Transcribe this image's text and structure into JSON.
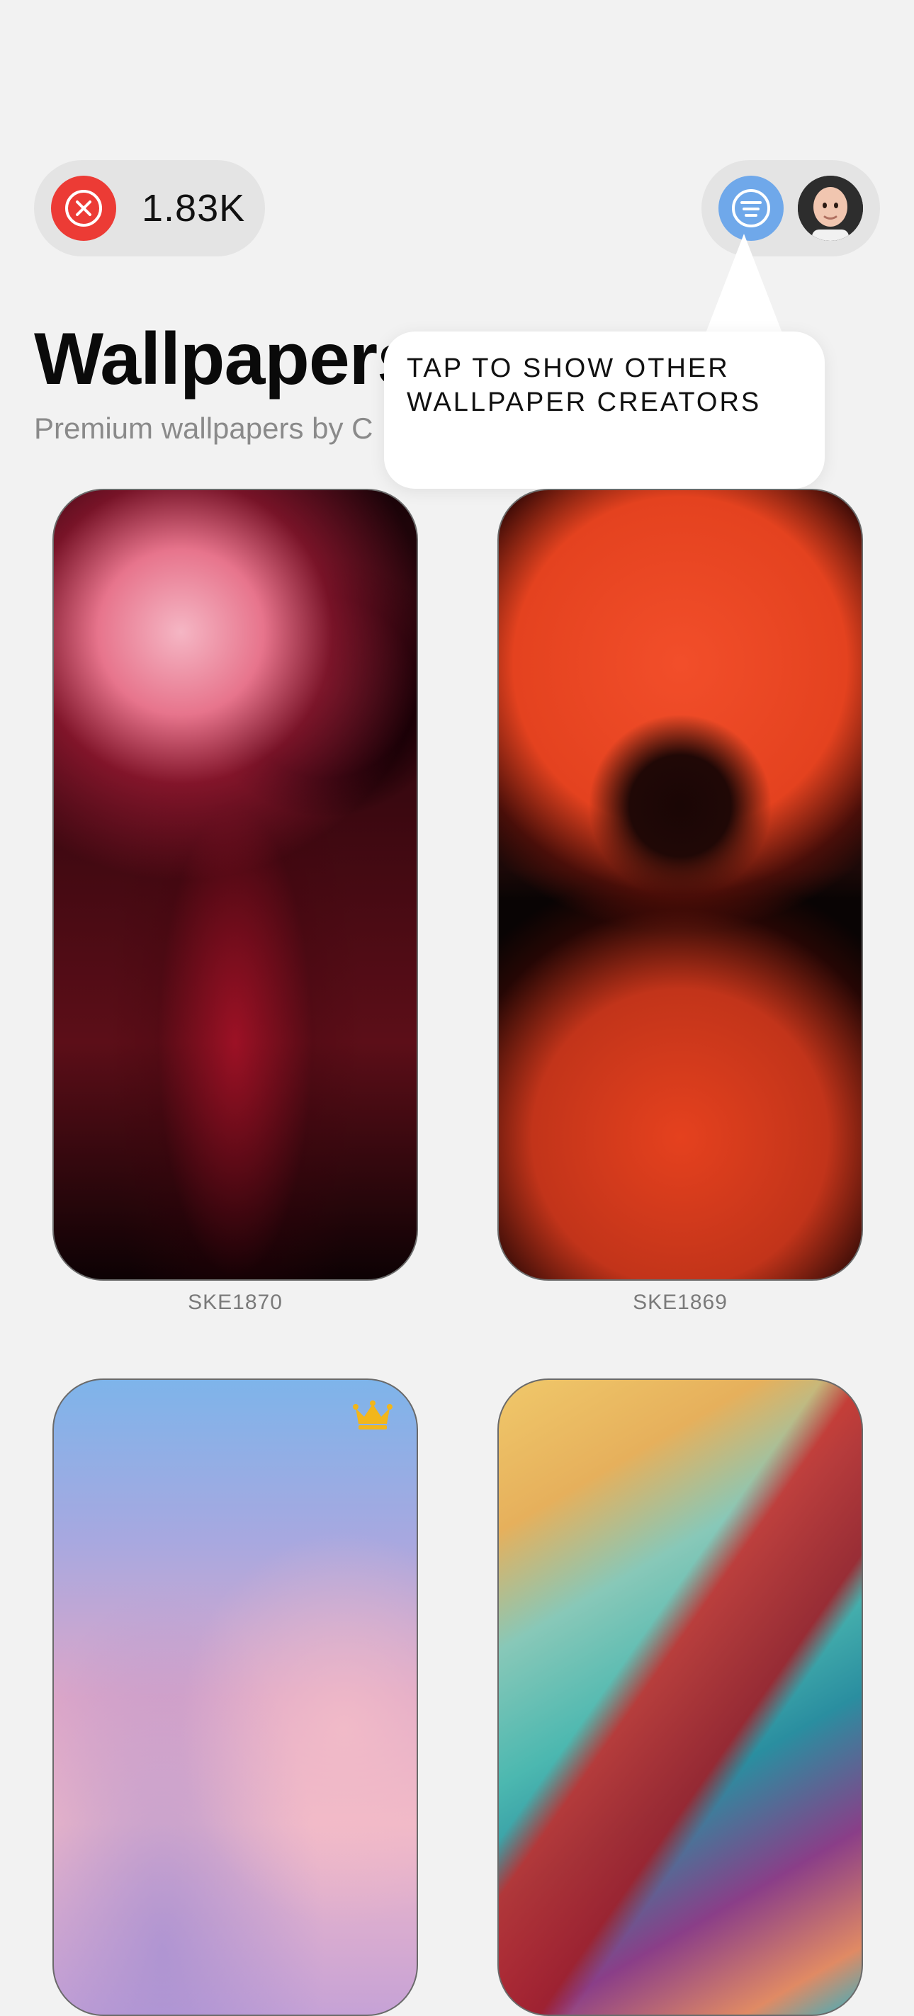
{
  "header": {
    "close_icon": "close-x-circle-icon",
    "count": "1.83K",
    "filter_icon": "filter-lines-icon",
    "avatar": "user-avatar"
  },
  "page": {
    "title": "Wallpapers",
    "subtitle": "Premium wallpapers by C"
  },
  "tooltip": {
    "text": "TAP TO SHOW OTHER\nWALLPAPER  CREATORS"
  },
  "wallpapers": [
    {
      "label": "SKE1870",
      "premium": false
    },
    {
      "label": "SKE1869",
      "premium": false
    },
    {
      "label": "",
      "premium": true
    },
    {
      "label": "",
      "premium": false
    }
  ],
  "colors": {
    "close_red": "#ec3b35",
    "filter_blue": "#6fa8ea",
    "crown_gold": "#f2b61b",
    "background": "#f2f2f2"
  }
}
